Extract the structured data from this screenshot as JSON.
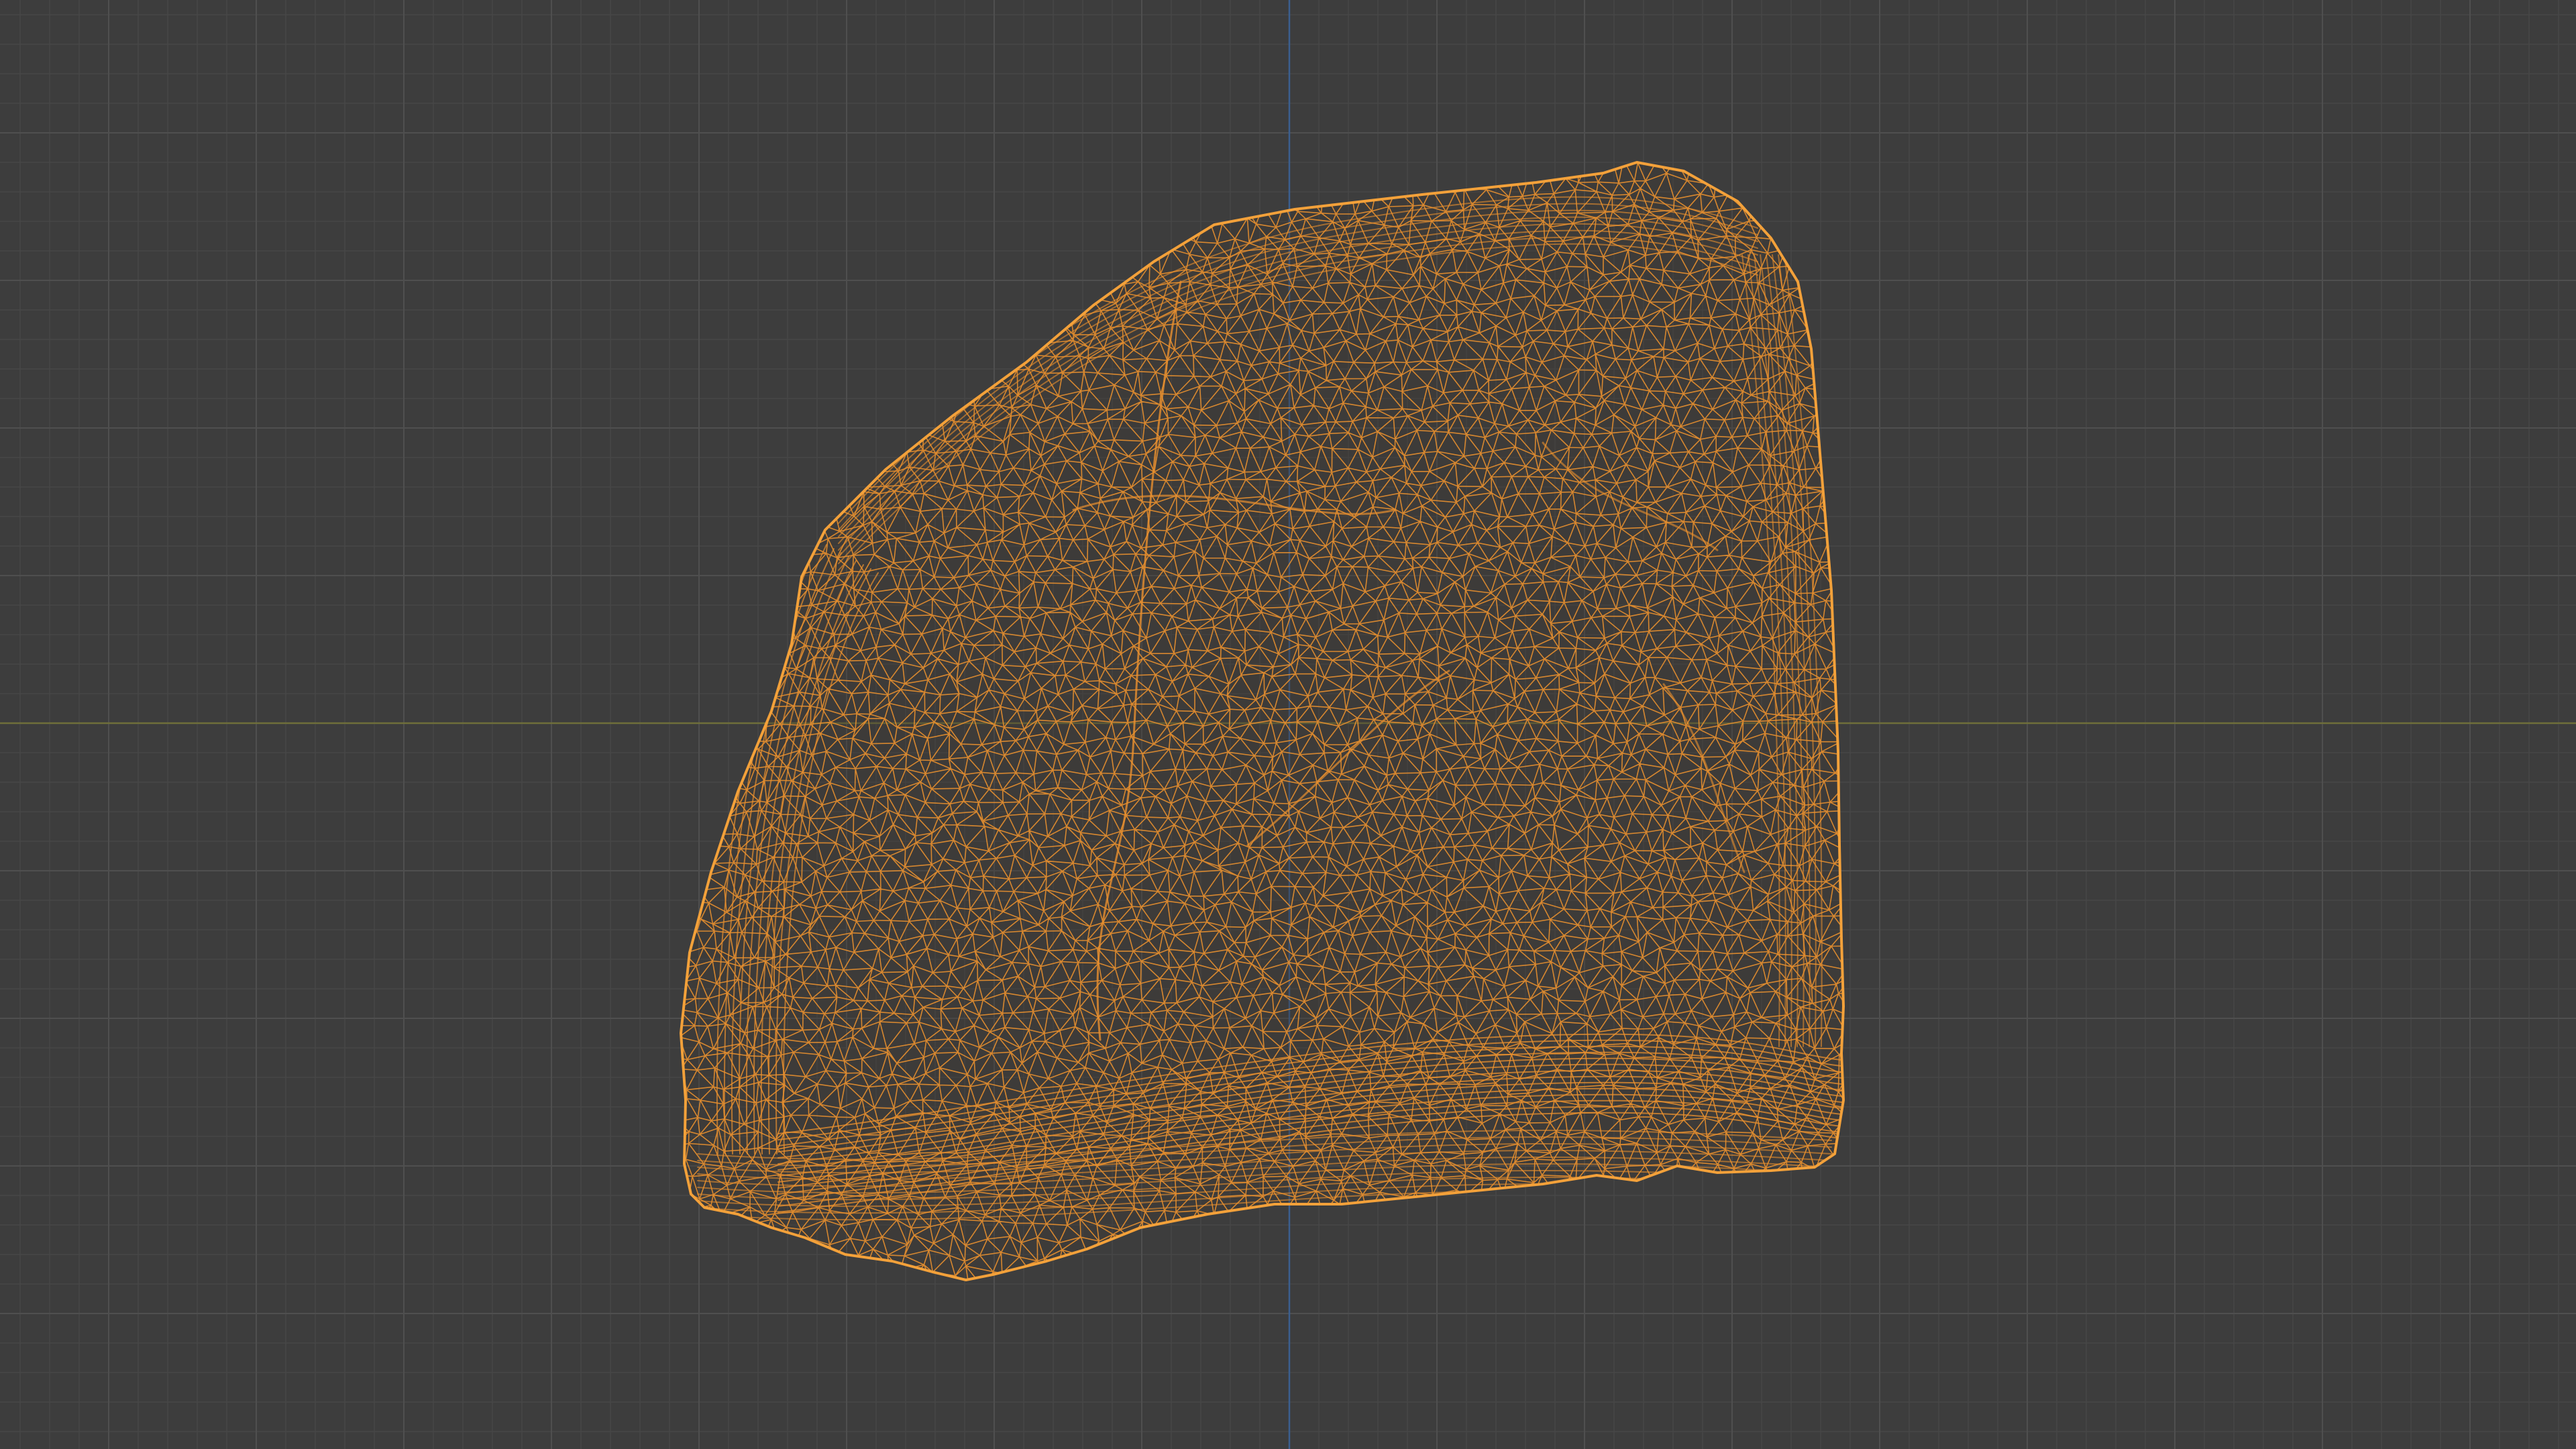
{
  "viewport": {
    "mode": "wireframe",
    "background_color": "#3d3d3d",
    "grid_minor_color": "#474747",
    "grid_major_color": "#4f4f4f",
    "x_axis_color": "#6f6f3a",
    "y_axis_color": "#3b5f8f"
  },
  "mesh": {
    "kind": "rock-scan",
    "selected": true,
    "wire_color": "#e8902f",
    "highlight_color": "#f3a13a"
  }
}
